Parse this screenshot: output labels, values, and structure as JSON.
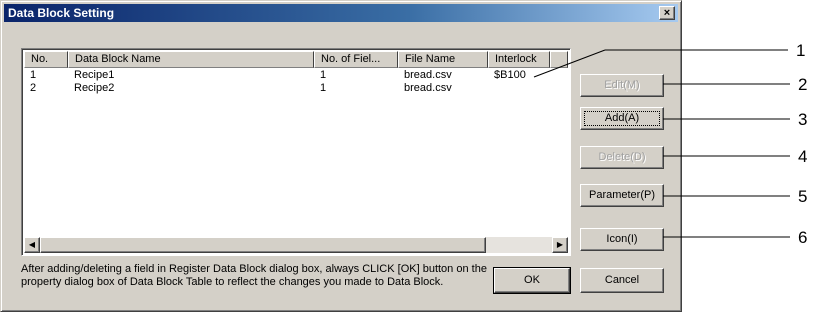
{
  "dialog": {
    "title": "Data Block Setting",
    "close_label": "×"
  },
  "table": {
    "headers": [
      "No.",
      "Data Block Name",
      "No. of Fiel...",
      "File Name",
      "Interlock"
    ],
    "rows": [
      [
        "1",
        "Recipe1",
        "1",
        "bread.csv",
        "$B100"
      ],
      [
        "2",
        "Recipe2",
        "1",
        "bread.csv",
        ""
      ]
    ],
    "scroll_left": "◀",
    "scroll_right": "▶"
  },
  "buttons": {
    "edit": "Edit(M)",
    "add": "Add(A)",
    "delete": "Delete(D)",
    "parameter": "Parameter(P)",
    "icon": "Icon(I)",
    "ok": "OK",
    "cancel": "Cancel"
  },
  "note": "After adding/deleting a field in Register Data Block dialog box, always CLICK [OK] button on the property dialog box of Data Block Table to reflect the changes you made to Data Block.",
  "callouts": [
    "1",
    "2",
    "3",
    "4",
    "5",
    "6"
  ]
}
